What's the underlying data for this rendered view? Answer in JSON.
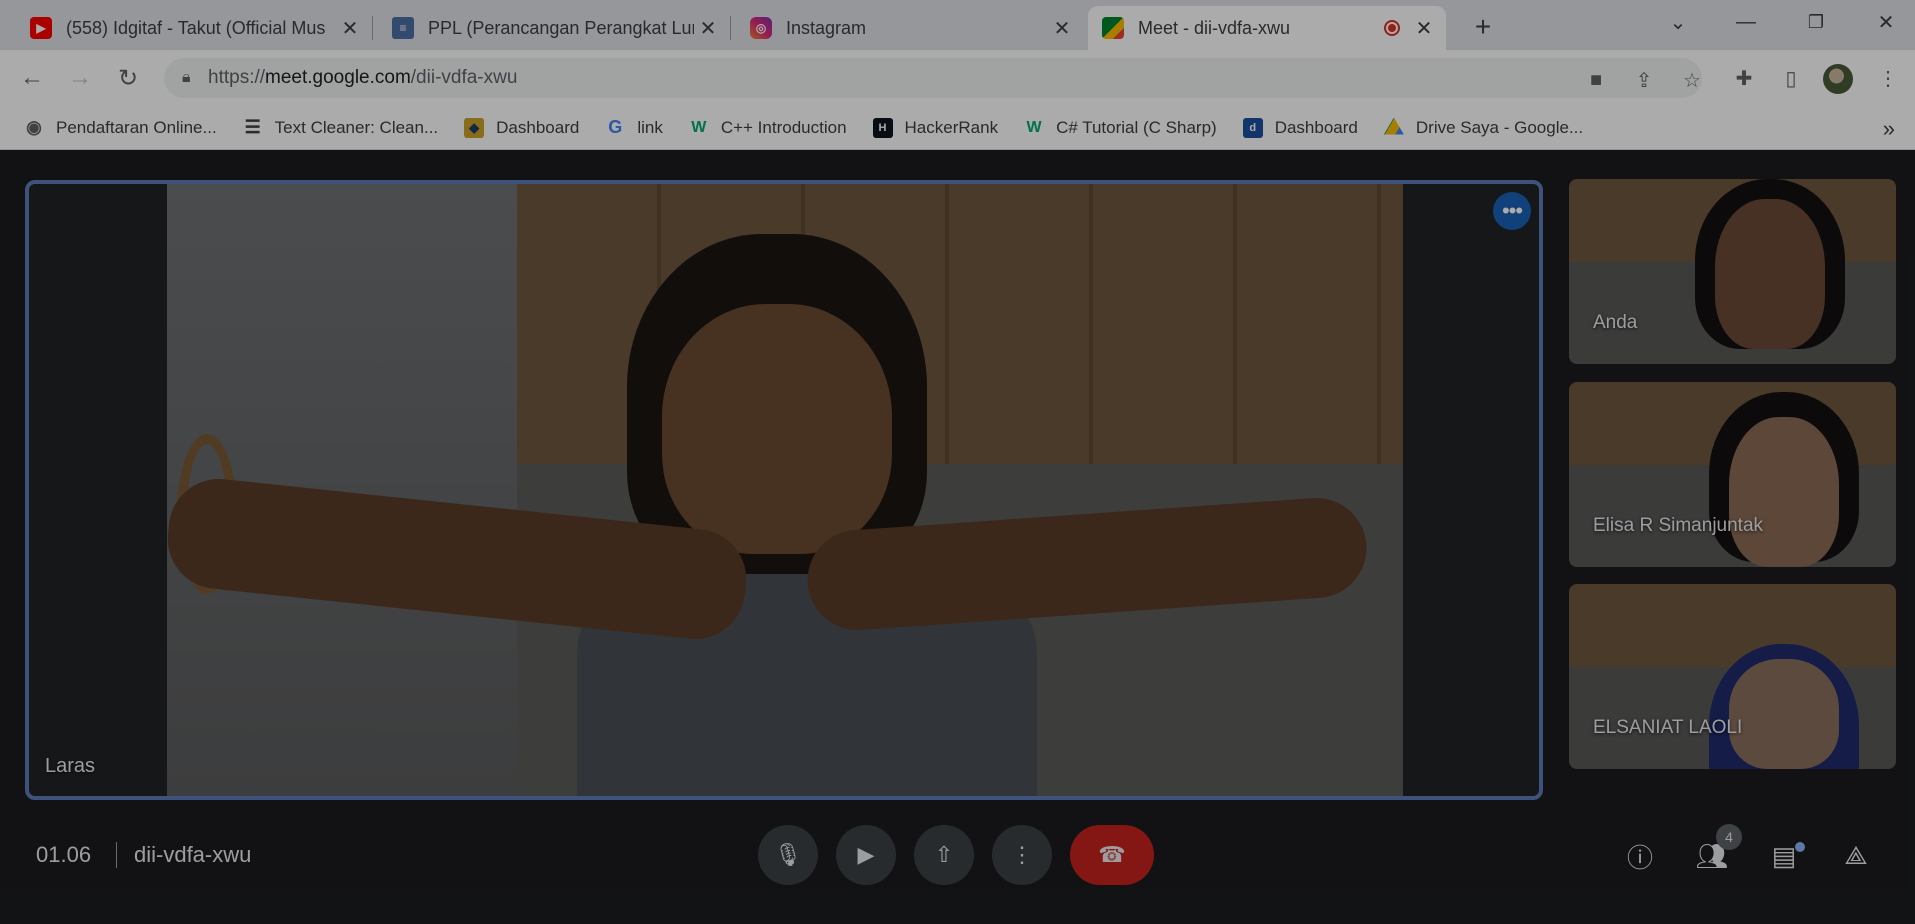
{
  "tabs": [
    {
      "title": "(558) Idgitaf - Takut (Official Mus",
      "icon": "youtube-icon"
    },
    {
      "title": "PPL (Perancangan Perangkat Lun",
      "icon": "docs-icon"
    },
    {
      "title": "Instagram",
      "icon": "instagram-icon"
    },
    {
      "title": "Meet - dii-vdfa-xwu",
      "icon": "meet-icon",
      "active": true
    }
  ],
  "address_bar": {
    "url_prefix": "https://",
    "url_host": "meet.google.com",
    "url_path": "/dii-vdfa-xwu"
  },
  "bookmarks": [
    {
      "label": "Pendaftaran Online...",
      "icon": "globe-icon"
    },
    {
      "label": "Text Cleaner: Clean...",
      "icon": "lines-icon"
    },
    {
      "label": "Dashboard",
      "icon": "dashboard-icon"
    },
    {
      "label": "link",
      "icon": "google-icon"
    },
    {
      "label": "C++ Introduction",
      "icon": "w3schools-icon"
    },
    {
      "label": "HackerRank",
      "icon": "hackerrank-icon"
    },
    {
      "label": "C# Tutorial (C Sharp)",
      "icon": "w3schools-icon"
    },
    {
      "label": "Dashboard",
      "icon": "del-icon"
    },
    {
      "label": "Drive Saya - Google...",
      "icon": "drive-icon"
    }
  ],
  "bookmarks_more": "»",
  "meet": {
    "main_participant": "Laras",
    "participants": [
      {
        "name": "Anda"
      },
      {
        "name": "Elisa R Simanjuntak"
      },
      {
        "name": "ELSANIAT LAOLI"
      }
    ],
    "time": "01.06",
    "meeting_code": "dii-vdfa-xwu",
    "participant_count": "4"
  },
  "colors": {
    "active_border": "#5b7cb8",
    "hangup": "#c5221f",
    "more_button": "#1a62b8"
  }
}
